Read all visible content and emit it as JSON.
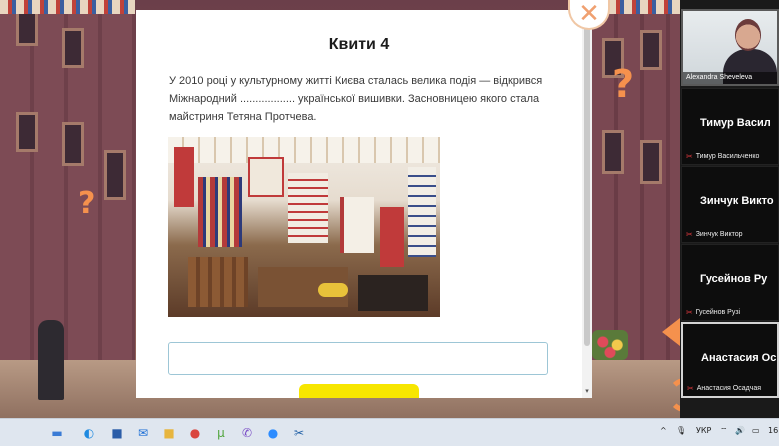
{
  "modal": {
    "title": "Квити 4",
    "text": "У 2010 році у культурному житті Києва сталась велика подія — відкрився Міжнародний .................. української вишивки. Засновницею якого стала майстриня Тетяна Протчева.",
    "answer_value": "",
    "close_glyph": "✕",
    "scroll_down_glyph": "▾"
  },
  "scene": {
    "question_glyph": "?"
  },
  "video": {
    "main_participant": "Alexandra Sheveleva",
    "tiles": [
      {
        "big": "Тимур  Васил",
        "small": "Тимур Васильченко"
      },
      {
        "big": "Зинчук Викто",
        "small": "Зинчук Виктор"
      },
      {
        "big": "Гусейнов Ру",
        "small": "Гусейнов Рузі"
      },
      {
        "big": "Анастасия  Ос",
        "small": "Анастасия Осадчая"
      }
    ],
    "mic_off_glyph": "✂"
  },
  "taskbar": {
    "language": "УКР",
    "clock": "16",
    "tray_up_glyph": "^",
    "mic_glyph": "🎙",
    "wifi_glyph": "⌔",
    "volume_glyph": "🔊",
    "battery_glyph": "▭",
    "apps": [
      {
        "name": "landscape",
        "glyph": "▬",
        "color": "#3a7bd5"
      },
      {
        "name": "edge",
        "glyph": "◐",
        "color": "#1f8ae0"
      },
      {
        "name": "store",
        "glyph": "■",
        "color": "#2b5da8"
      },
      {
        "name": "mail",
        "glyph": "✉",
        "color": "#1d6fd6"
      },
      {
        "name": "folder",
        "glyph": "■",
        "color": "#e7b53e"
      },
      {
        "name": "chrome",
        "glyph": "●",
        "color": "#d9463e"
      },
      {
        "name": "torrent",
        "glyph": "μ",
        "color": "#4fa43a"
      },
      {
        "name": "viber",
        "glyph": "✆",
        "color": "#7b4fc7"
      },
      {
        "name": "zoom",
        "glyph": "●",
        "color": "#2d8cff"
      },
      {
        "name": "snip",
        "glyph": "✂",
        "color": "#2563a8"
      }
    ]
  }
}
